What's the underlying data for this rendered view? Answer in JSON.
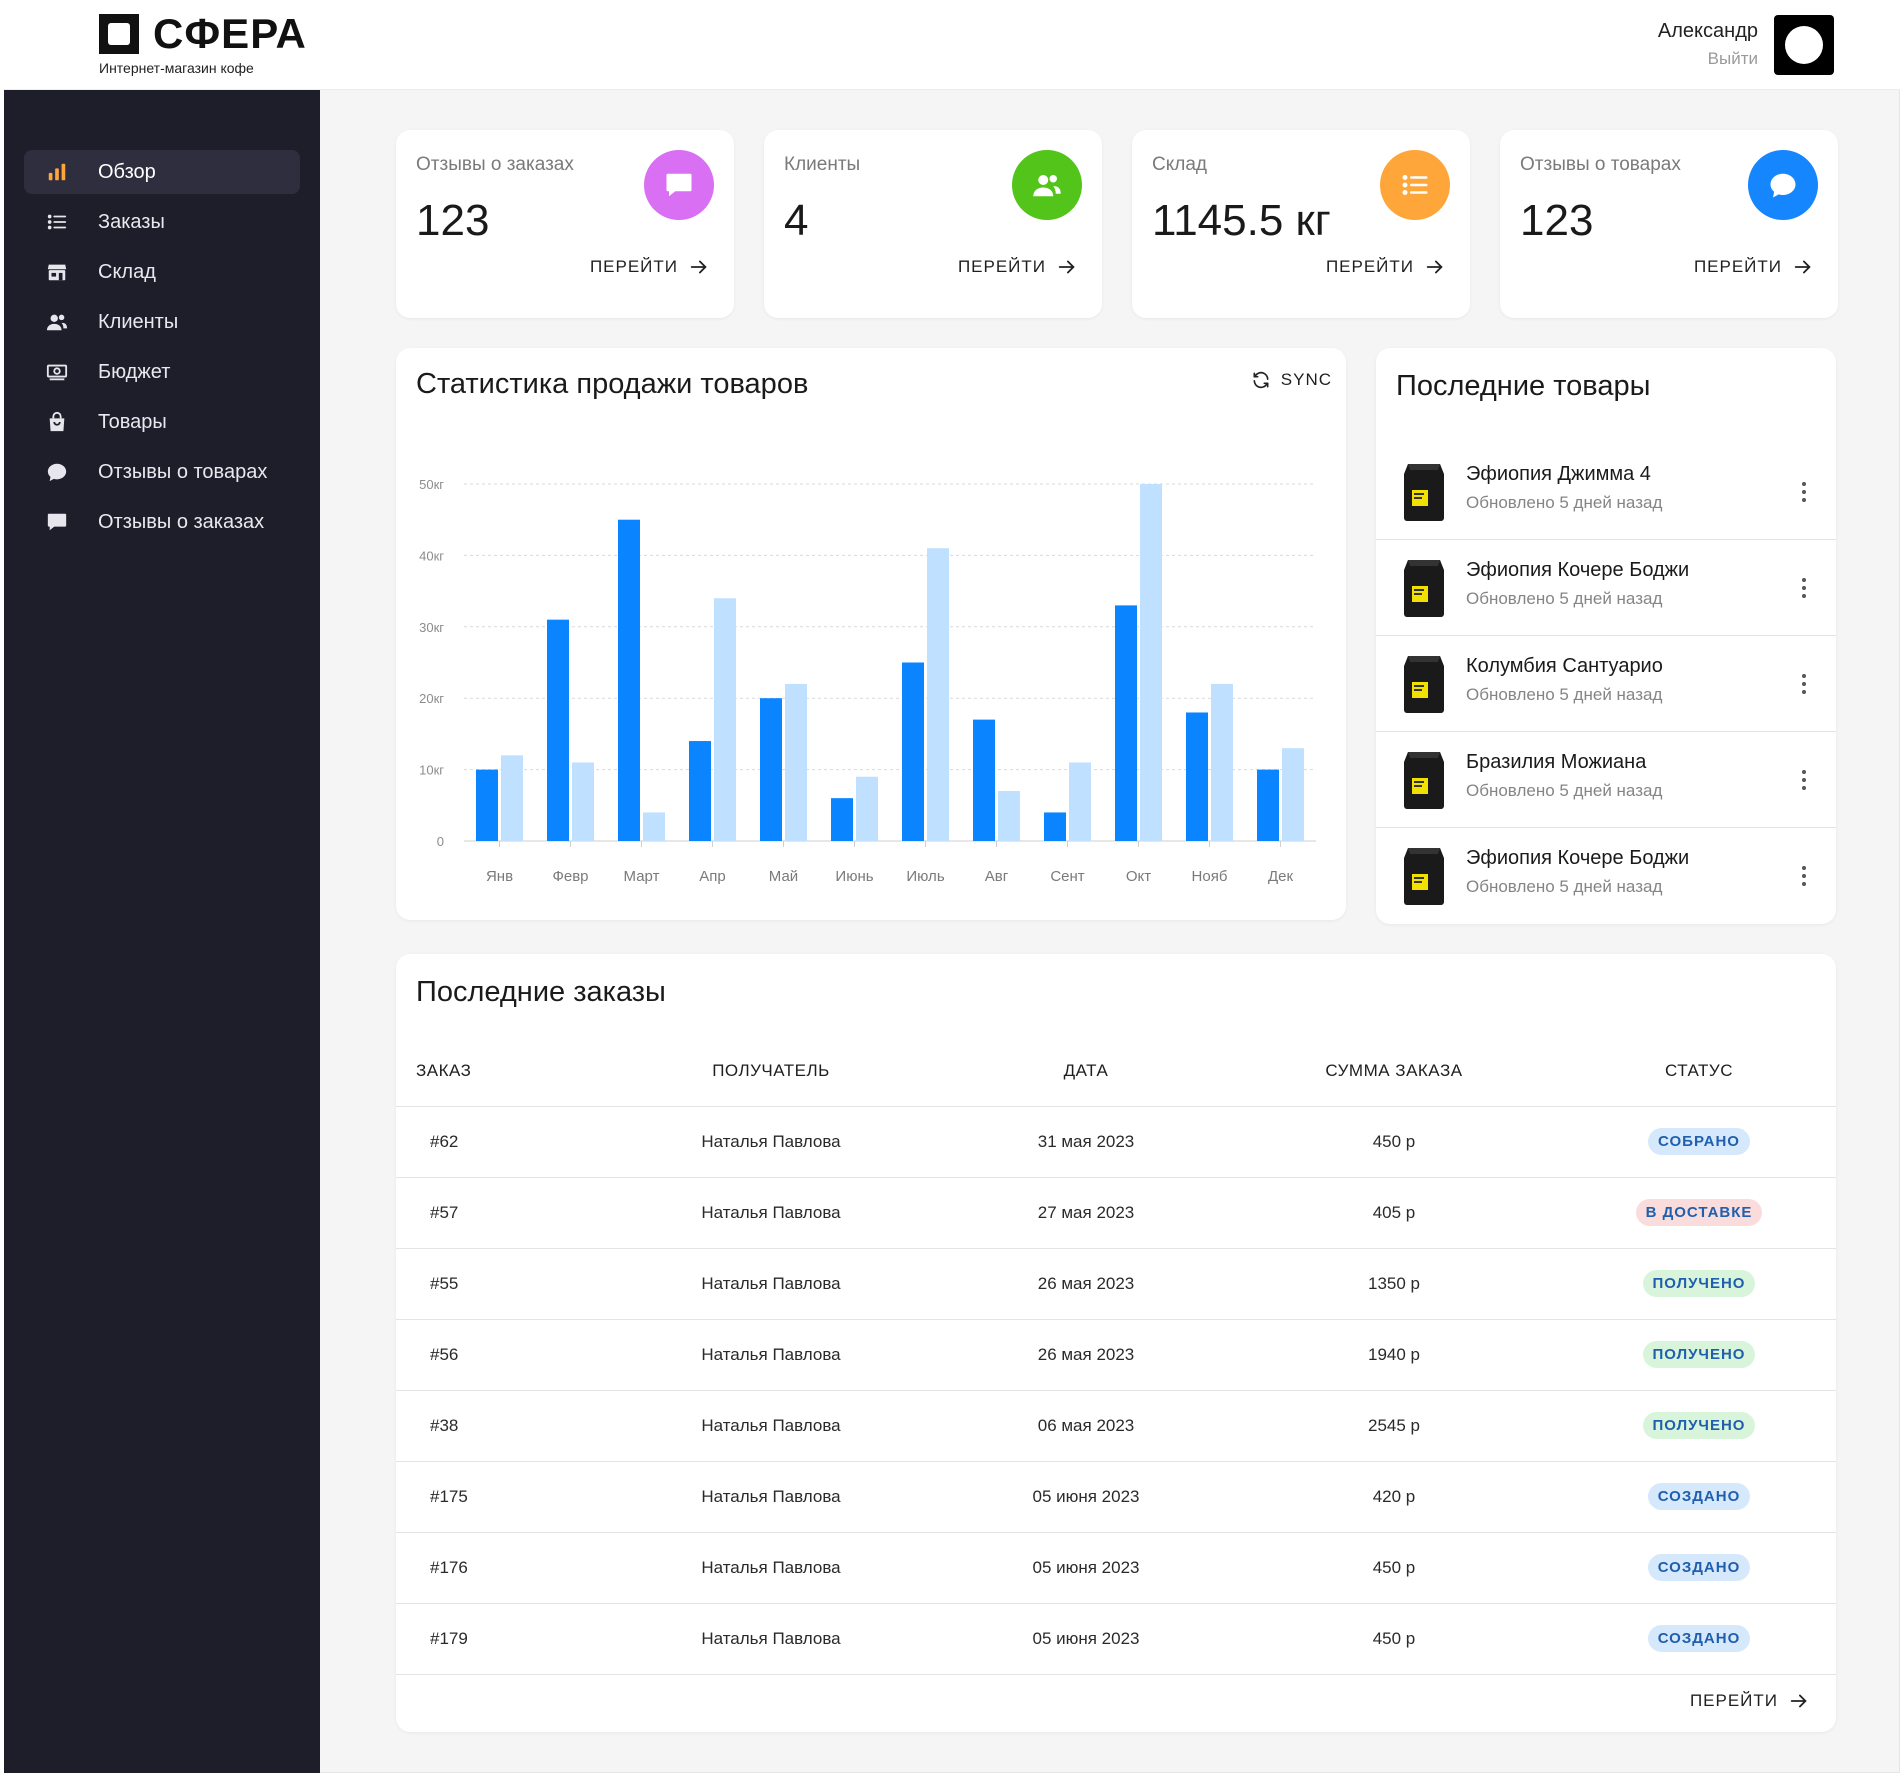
{
  "header": {
    "logo_text": "СФЕРА",
    "logo_subtitle": "Интернет-магазин кофе",
    "user_name": "Александр",
    "logout_label": "Выйти"
  },
  "sidebar": {
    "items": [
      {
        "label": "Обзор",
        "icon": "bar-chart-icon",
        "active": true
      },
      {
        "label": "Заказы",
        "icon": "list-icon",
        "active": false
      },
      {
        "label": "Склад",
        "icon": "store-icon",
        "active": false
      },
      {
        "label": "Клиенты",
        "icon": "people-icon",
        "active": false
      },
      {
        "label": "Бюджет",
        "icon": "money-icon",
        "active": false
      },
      {
        "label": "Товары",
        "icon": "bag-icon",
        "active": false
      },
      {
        "label": "Отзывы о товарах",
        "icon": "chat-bubble-icon",
        "active": false
      },
      {
        "label": "Отзывы о заказах",
        "icon": "comment-icon",
        "active": false
      }
    ]
  },
  "stats": [
    {
      "label": "Отзывы о заказах",
      "value": "123",
      "link": "ПЕРЕЙТИ",
      "icon": "comment-icon",
      "color": "#d96ff2"
    },
    {
      "label": "Клиенты",
      "value": "4",
      "link": "ПЕРЕЙТИ",
      "icon": "people-icon",
      "color": "#52c41a"
    },
    {
      "label": "Склад",
      "value": "1145.5 кг",
      "link": "ПЕРЕЙТИ",
      "icon": "list-icon",
      "color": "#ffa63a"
    },
    {
      "label": "Отзывы о товарах",
      "value": "123",
      "link": "ПЕРЕЙТИ",
      "icon": "chat-bubble-icon",
      "color": "#1686ff"
    }
  ],
  "chart": {
    "title": "Статистика продажи товаров",
    "sync_label": "SYNC"
  },
  "chart_data": {
    "type": "bar",
    "categories": [
      "Янв",
      "Февр",
      "Март",
      "Апр",
      "Май",
      "Июнь",
      "Июль",
      "Авг",
      "Сент",
      "Окт",
      "Нояб",
      "Дек"
    ],
    "series": [
      {
        "values": [
          10,
          31,
          45,
          14,
          20,
          6,
          25,
          17,
          4,
          33,
          18,
          10
        ],
        "color": "#0a84ff"
      },
      {
        "values": [
          12,
          11,
          4,
          34,
          22,
          9,
          41,
          7,
          11,
          50,
          22,
          13
        ],
        "color": "#bfe0ff"
      }
    ],
    "y_ticks": [
      "0",
      "10кг",
      "20кг",
      "30кг",
      "40кг",
      "50кг"
    ],
    "ylim": [
      0,
      50
    ],
    "grid": true
  },
  "products": {
    "title": "Последние товары",
    "items": [
      {
        "name": "Эфиопия Джимма 4",
        "updated": "Обновлено 5 дней назад"
      },
      {
        "name": "Эфиопия Кочере Боджи",
        "updated": "Обновлено 5 дней назад"
      },
      {
        "name": "Колумбия Сантуарио",
        "updated": "Обновлено 5 дней назад"
      },
      {
        "name": "Бразилия Можиана",
        "updated": "Обновлено 5 дней назад"
      },
      {
        "name": "Эфиопия Кочере Боджи",
        "updated": "Обновлено 5 дней назад"
      }
    ]
  },
  "orders": {
    "title": "Последние заказы",
    "columns": [
      "ЗАКАЗ",
      "ПОЛУЧАТЕЛЬ",
      "ДАТА",
      "СУММА ЗАКАЗА",
      "СТАТУС"
    ],
    "link": "ПЕРЕЙТИ",
    "rows": [
      {
        "id": "#62",
        "recipient": "Наталья Павлова",
        "date": "31 мая 2023",
        "sum": "450 р",
        "status": "СОБРАНО",
        "bg": "#d6e8fb",
        "fg": "#1f5fad"
      },
      {
        "id": "#57",
        "recipient": "Наталья Павлова",
        "date": "27 мая 2023",
        "sum": "405 р",
        "status": "В ДОСТАВКЕ",
        "bg": "#fadcdc",
        "fg": "#1f5fad"
      },
      {
        "id": "#55",
        "recipient": "Наталья Павлова",
        "date": "26 мая 2023",
        "sum": "1350 р",
        "status": "ПОЛУЧЕНО",
        "bg": "#d8f5dc",
        "fg": "#1f5fad"
      },
      {
        "id": "#56",
        "recipient": "Наталья Павлова",
        "date": "26 мая 2023",
        "sum": "1940 р",
        "status": "ПОЛУЧЕНО",
        "bg": "#d8f5dc",
        "fg": "#1f5fad"
      },
      {
        "id": "#38",
        "recipient": "Наталья Павлова",
        "date": "06 мая 2023",
        "sum": "2545 р",
        "status": "ПОЛУЧЕНО",
        "bg": "#d8f5dc",
        "fg": "#1f5fad"
      },
      {
        "id": "#175",
        "recipient": "Наталья Павлова",
        "date": "05 июня 2023",
        "sum": "420 р",
        "status": "СОЗДАНО",
        "bg": "#d6e8fb",
        "fg": "#1f5fad"
      },
      {
        "id": "#176",
        "recipient": "Наталья Павлова",
        "date": "05 июня 2023",
        "sum": "450 р",
        "status": "СОЗДАНО",
        "bg": "#d6e8fb",
        "fg": "#1f5fad"
      },
      {
        "id": "#179",
        "recipient": "Наталья Павлова",
        "date": "05 июня 2023",
        "sum": "450 р",
        "status": "СОЗДАНО",
        "bg": "#d6e8fb",
        "fg": "#1f5fad"
      }
    ]
  }
}
